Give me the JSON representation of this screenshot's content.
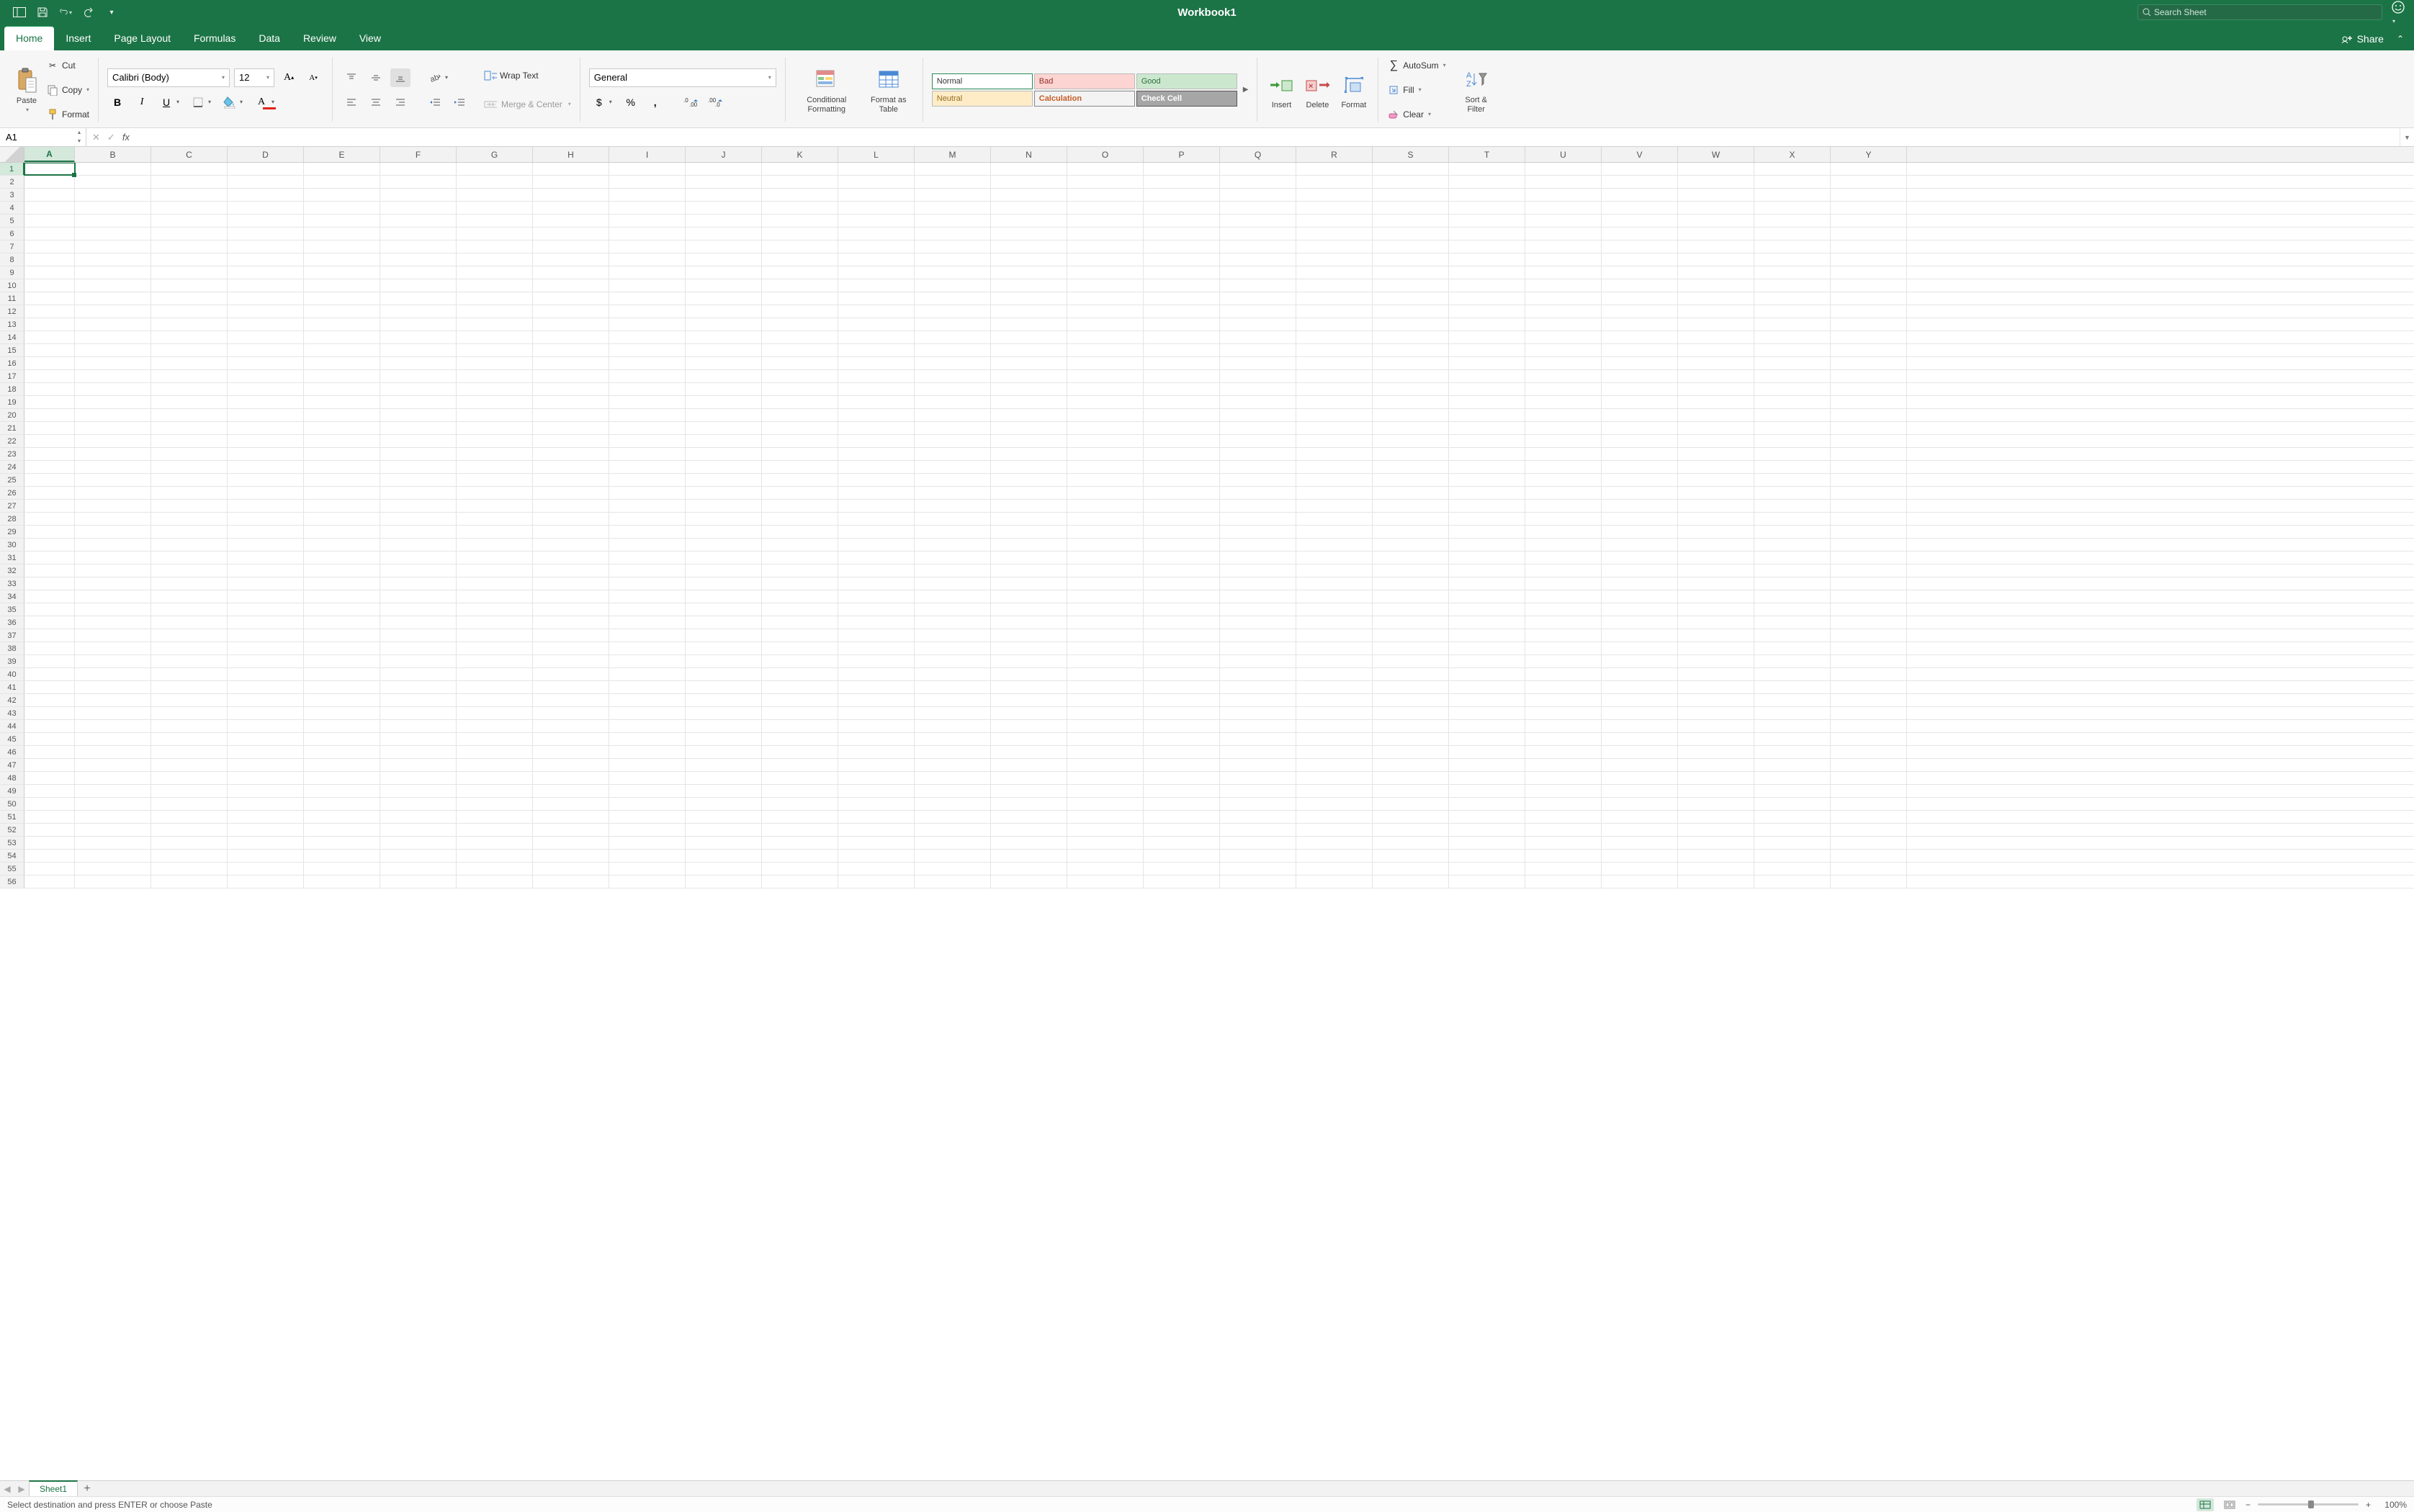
{
  "titlebar": {
    "workbook": "Workbook1",
    "search_placeholder": "Search Sheet"
  },
  "tabs": {
    "items": [
      "Home",
      "Insert",
      "Page Layout",
      "Formulas",
      "Data",
      "Review",
      "View"
    ],
    "active": 0,
    "share": "Share"
  },
  "ribbon": {
    "clipboard": {
      "paste": "Paste",
      "cut": "Cut",
      "copy": "Copy",
      "format": "Format"
    },
    "font": {
      "name": "Calibri (Body)",
      "size": "12"
    },
    "alignment": {
      "wrap": "Wrap Text",
      "merge": "Merge & Center"
    },
    "number": {
      "format": "General"
    },
    "tables": {
      "cond": "Conditional Formatting",
      "fat": "Format as Table"
    },
    "styles": {
      "normal": "Normal",
      "bad": "Bad",
      "good": "Good",
      "neutral": "Neutral",
      "calc": "Calculation",
      "check": "Check Cell"
    },
    "cells": {
      "insert": "Insert",
      "delete": "Delete",
      "format": "Format"
    },
    "editing": {
      "autosum": "AutoSum",
      "fill": "Fill",
      "clear": "Clear",
      "sort": "Sort & Filter"
    }
  },
  "namebox": {
    "ref": "A1"
  },
  "grid": {
    "columns": [
      "A",
      "B",
      "C",
      "D",
      "E",
      "F",
      "G",
      "H",
      "I",
      "J",
      "K",
      "L",
      "M",
      "N",
      "O",
      "P",
      "Q",
      "R",
      "S",
      "T",
      "U",
      "V",
      "W",
      "X",
      "Y"
    ],
    "col_widths": {
      "default": 106,
      "first": 70
    },
    "row_count": 56,
    "selected": {
      "col": 0,
      "row": 0
    }
  },
  "sheets": {
    "active": "Sheet1"
  },
  "status": {
    "message": "Select destination and press ENTER or choose Paste",
    "zoom": "100%"
  }
}
